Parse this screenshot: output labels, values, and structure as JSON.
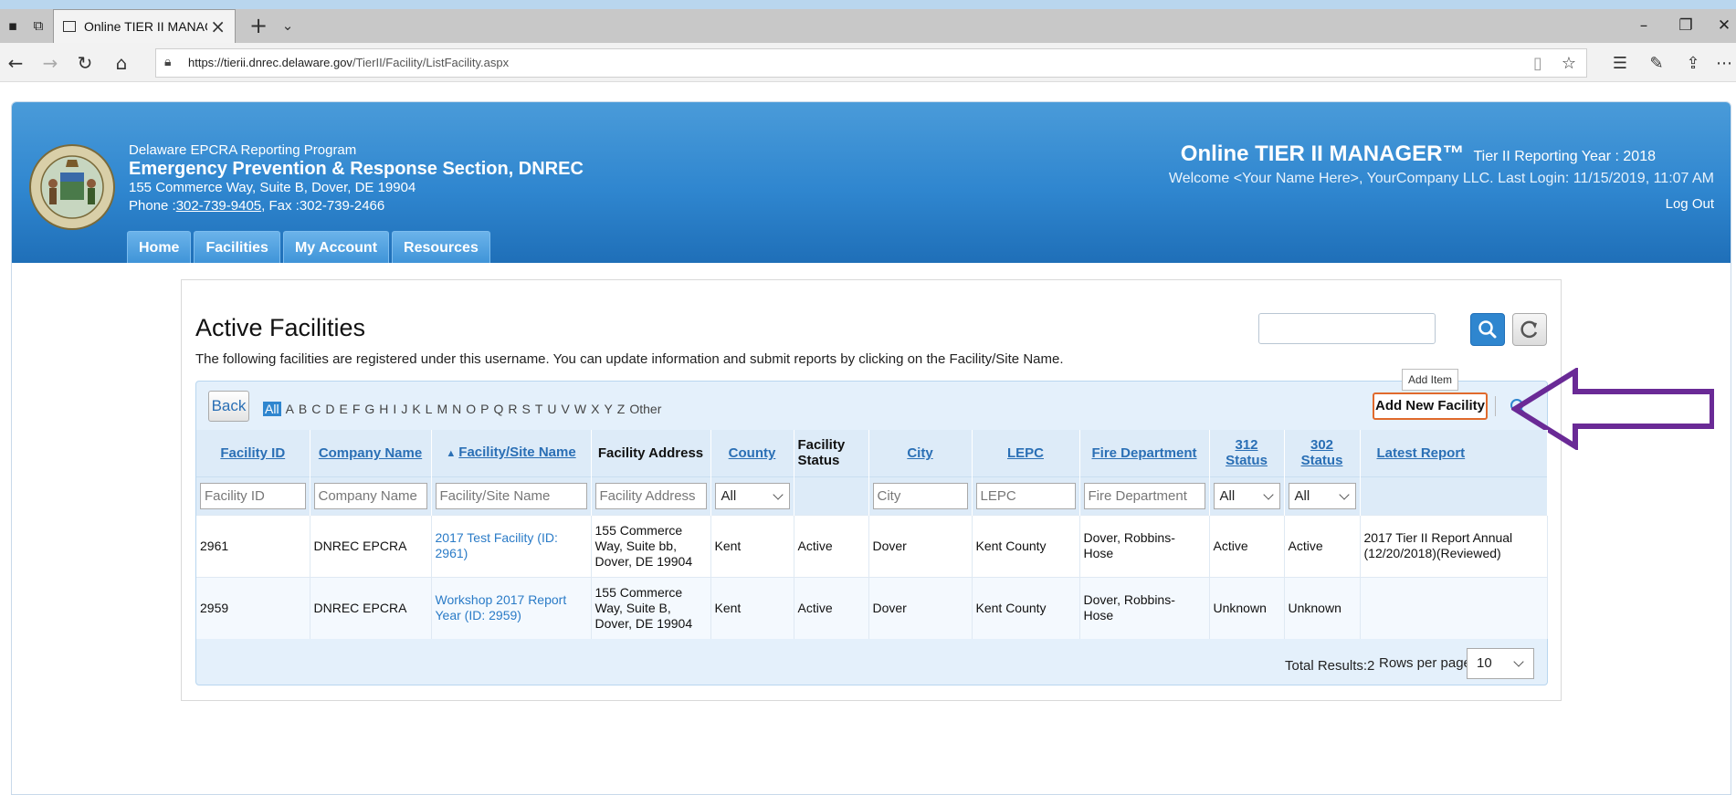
{
  "browser": {
    "tab_title": "Online TIER II MANAGEI",
    "url_host": "https://tierii.dnrec.delaware.gov",
    "url_path": "/TierII/Facility/ListFacility.aspx"
  },
  "header": {
    "program": "Delaware EPCRA Reporting Program",
    "section": "Emergency Prevention & Response Section, DNREC",
    "address": "155 Commerce Way, Suite B, Dover, DE 19904",
    "phone_label": "Phone :",
    "phone": "302-739-9405",
    "fax": ", Fax :302-739-2466",
    "app_title": "Online TIER II MANAGER™",
    "reporting_year": "Tier II Reporting Year : 2018",
    "welcome": "Welcome <Your Name Here>, YourCompany LLC.  Last Login: 11/15/2019, 11:07 AM",
    "logout": "Log Out",
    "nav": [
      "Home",
      "Facilities",
      "My Account",
      "Resources"
    ]
  },
  "page": {
    "title": "Active Facilities",
    "description": "The following facilities are registered under this username. You can update information and submit reports by clicking on the Facility/Site Name.",
    "back": "Back",
    "alphabet": [
      "All",
      "A",
      "B",
      "C",
      "D",
      "E",
      "F",
      "G",
      "H",
      "I",
      "J",
      "K",
      "L",
      "M",
      "N",
      "O",
      "P",
      "Q",
      "R",
      "S",
      "T",
      "U",
      "V",
      "W",
      "X",
      "Y",
      "Z",
      "Other"
    ],
    "tooltip": "Add Item",
    "add_new": "Add New Facility"
  },
  "table": {
    "headers": {
      "facility_id": "Facility ID",
      "company": "Company Name",
      "site": "Facility/Site Name",
      "address": "Facility Address",
      "county": "County",
      "status_1": "Facility",
      "status_2": "Status",
      "city": "City",
      "lepc": "LEPC",
      "fire": "Fire Department",
      "s312_1": "312",
      "s312_2": "Status",
      "s302_1": "302",
      "s302_2": "Status",
      "latest": "Latest Report"
    },
    "filters": {
      "facility_id": "Facility ID",
      "company": "Company Name",
      "site": "Facility/Site Name",
      "address": "Facility Address",
      "county": "All",
      "city": "City",
      "lepc": "LEPC",
      "fire": "Fire Department",
      "s312": "All",
      "s302": "All"
    },
    "rows": [
      {
        "id": "2961",
        "company": "DNREC EPCRA",
        "site": "2017 Test Facility (ID: 2961)",
        "address": "155 Commerce Way, Suite bb, Dover, DE 19904",
        "county": "Kent",
        "status": "Active",
        "city": "Dover",
        "lepc": "Kent County",
        "fire": "Dover, Robbins-Hose",
        "s312": "Active",
        "s302": "Active",
        "latest": "2017 Tier II Report Annual (12/20/2018)(Reviewed)"
      },
      {
        "id": "2959",
        "company": "DNREC EPCRA",
        "site": "Workshop 2017 Report Year (ID: 2959)",
        "address": "155 Commerce Way, Suite B, Dover, DE 19904",
        "county": "Kent",
        "status": "Active",
        "city": "Dover",
        "lepc": "Kent County",
        "fire": "Dover, Robbins-Hose",
        "s312": "Unknown",
        "s302": "Unknown",
        "latest": ""
      }
    ],
    "total_results": "Total Results:2",
    "rows_per_page_label": "Rows per page",
    "rows_per_page": "10"
  },
  "colors": {
    "header_blue": "#2f86cf",
    "link_blue": "#2a6fb5",
    "highlight_orange": "#e06a2c",
    "arrow_purple": "#6a2a96"
  }
}
